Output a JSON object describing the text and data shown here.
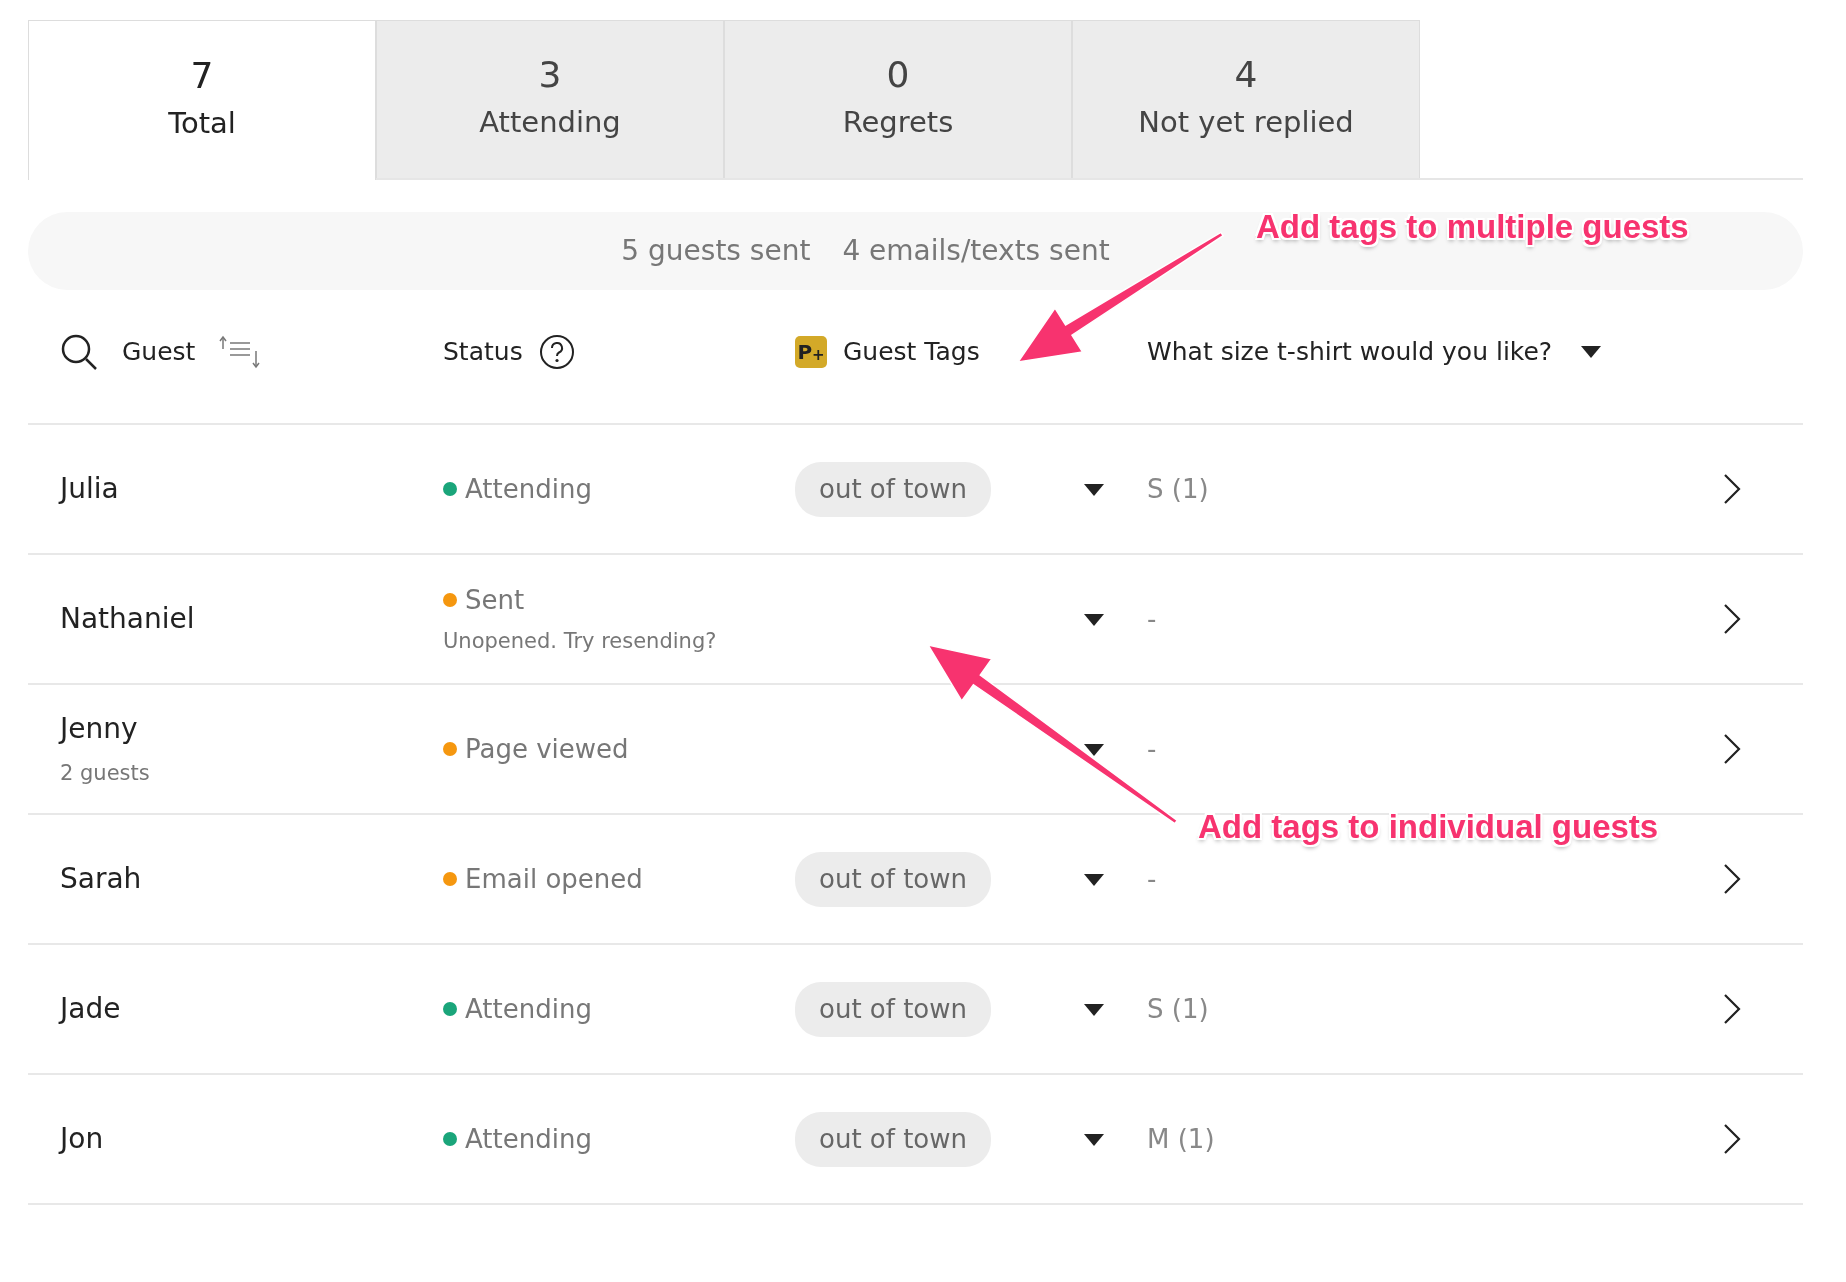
{
  "tabs": [
    {
      "count": "7",
      "label": "Total",
      "selected": true
    },
    {
      "count": "3",
      "label": "Attending",
      "selected": false
    },
    {
      "count": "0",
      "label": "Regrets",
      "selected": false
    },
    {
      "count": "4",
      "label": "Not yet replied",
      "selected": false
    }
  ],
  "summary": [
    "5 guests sent",
    "4 emails/texts sent"
  ],
  "columns": {
    "guest": "Guest",
    "status": "Status",
    "tags": "Guest Tags",
    "tags_icon": "P$_{+}$",
    "question": "What size t-shirt would you like?"
  },
  "rows": [
    {
      "name": "Julia",
      "status": "Attending",
      "color": "#1aa57a",
      "tag": "out of town",
      "answer": "S (1)"
    },
    {
      "name": "Nathaniel",
      "status": "Sent",
      "color": "#f5970f",
      "note": "Unopened. Try resending?",
      "answer": "-"
    },
    {
      "name": "Jenny",
      "sub": "2 guests",
      "status": "Page viewed",
      "color": "#f5970f",
      "answer": "-"
    },
    {
      "name": "Sarah",
      "status": "Email opened",
      "color": "#f5970f",
      "tag": "out of town",
      "answer": "-"
    },
    {
      "name": "Jade",
      "status": "Attending",
      "color": "#1aa57a",
      "tag": "out of town",
      "answer": "S (1)"
    },
    {
      "name": "Jon",
      "status": "Attending",
      "color": "#1aa57a",
      "tag": "out of town",
      "answer": "M (1)"
    }
  ],
  "annotations": [
    {
      "text": "Add tags to multiple guests"
    },
    {
      "text": "Add tags to individual guests"
    }
  ]
}
